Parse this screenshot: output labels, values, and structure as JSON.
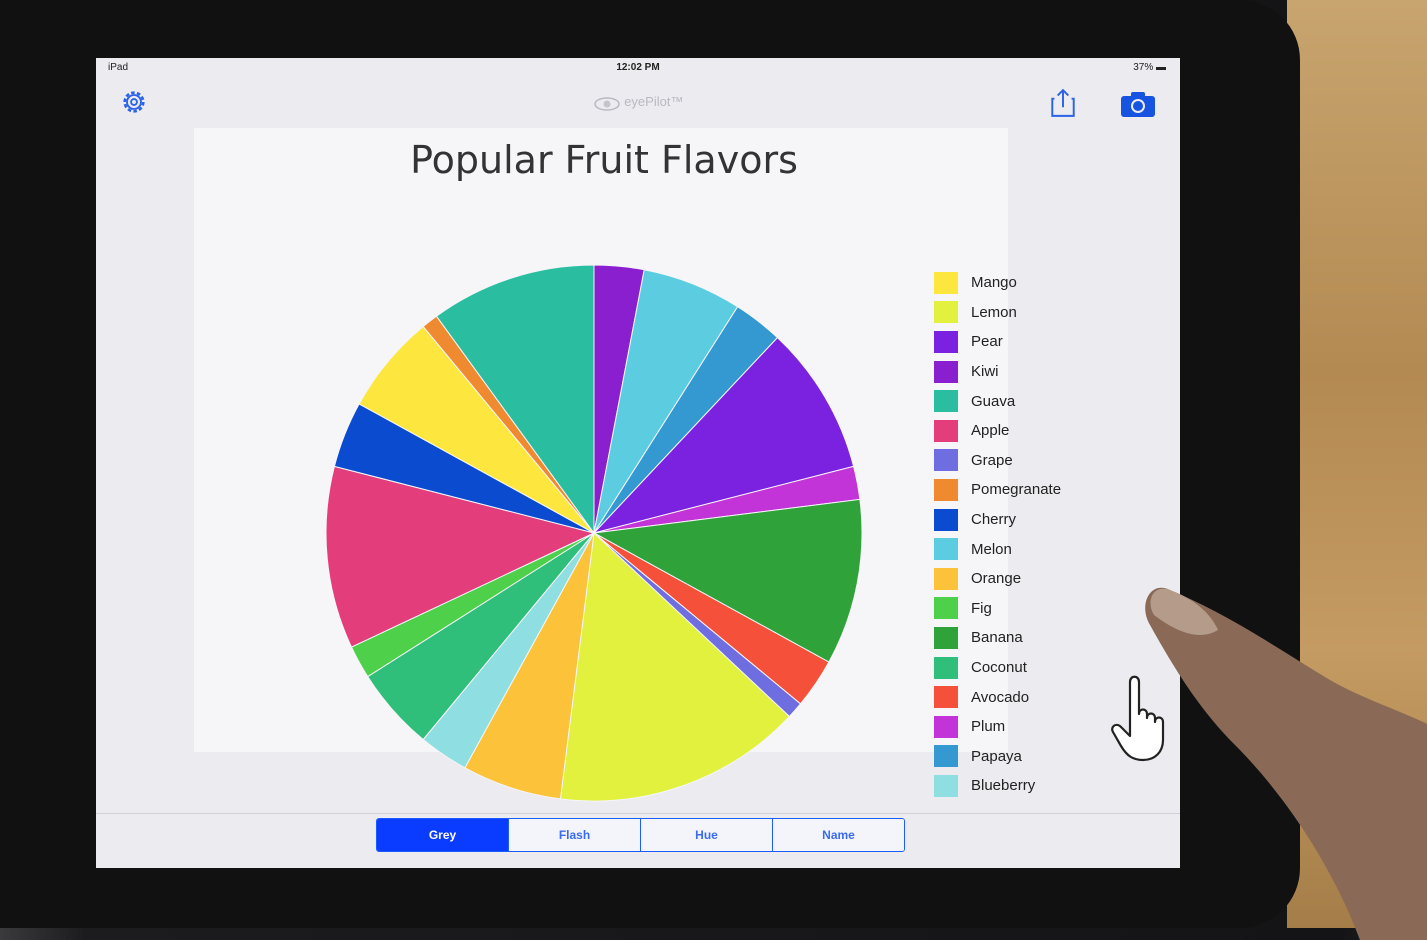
{
  "status_bar": {
    "device": "iPad",
    "time": "12:02 PM",
    "battery": "37%"
  },
  "nav_bar": {
    "app_name": "eyePilot™"
  },
  "chart_data": {
    "type": "pie",
    "title": "Popular Fruit Flavors",
    "slices": [
      {
        "label": "Kiwi",
        "value": 3
      },
      {
        "label": "Melon",
        "value": 6
      },
      {
        "label": "Papaya",
        "value": 3
      },
      {
        "label": "Pear",
        "value": 9
      },
      {
        "label": "Plum",
        "value": 2
      },
      {
        "label": "Banana",
        "value": 10
      },
      {
        "label": "Avocado",
        "value": 3
      },
      {
        "label": "Grape",
        "value": 1
      },
      {
        "label": "Lemon",
        "value": 15
      },
      {
        "label": "Orange",
        "value": 6
      },
      {
        "label": "Blueberry",
        "value": 3
      },
      {
        "label": "Coconut",
        "value": 5
      },
      {
        "label": "Fig",
        "value": 2
      },
      {
        "label": "Apple",
        "value": 11
      },
      {
        "label": "Cherry",
        "value": 4
      },
      {
        "label": "Mango",
        "value": 6
      },
      {
        "label": "Pomegranate",
        "value": 1
      },
      {
        "label": "Guava",
        "value": 10
      }
    ],
    "legend": [
      {
        "label": "Mango",
        "color": "#fde73e"
      },
      {
        "label": "Lemon",
        "color": "#e2f03e"
      },
      {
        "label": "Pear",
        "color": "#7a22e0"
      },
      {
        "label": "Kiwi",
        "color": "#8a1fd0"
      },
      {
        "label": "Guava",
        "color": "#2bbd9f"
      },
      {
        "label": "Apple",
        "color": "#e43d7c"
      },
      {
        "label": "Grape",
        "color": "#6f6ee0"
      },
      {
        "label": "Pomegranate",
        "color": "#f08a30"
      },
      {
        "label": "Cherry",
        "color": "#0b4bd0"
      },
      {
        "label": "Melon",
        "color": "#5ccde0"
      },
      {
        "label": "Orange",
        "color": "#fbc23a"
      },
      {
        "label": "Fig",
        "color": "#4ed04a"
      },
      {
        "label": "Banana",
        "color": "#2fa33a"
      },
      {
        "label": "Coconut",
        "color": "#2fbf7a"
      },
      {
        "label": "Avocado",
        "color": "#f4503a"
      },
      {
        "label": "Plum",
        "color": "#c233d8"
      },
      {
        "label": "Papaya",
        "color": "#3399d0"
      },
      {
        "label": "Blueberry",
        "color": "#8fdfe2"
      }
    ],
    "legend_position": "right"
  },
  "segmented_control": {
    "options": [
      "Grey",
      "Flash",
      "Hue",
      "Name"
    ],
    "selected": "Grey"
  },
  "accent_color": "#0a3cff"
}
